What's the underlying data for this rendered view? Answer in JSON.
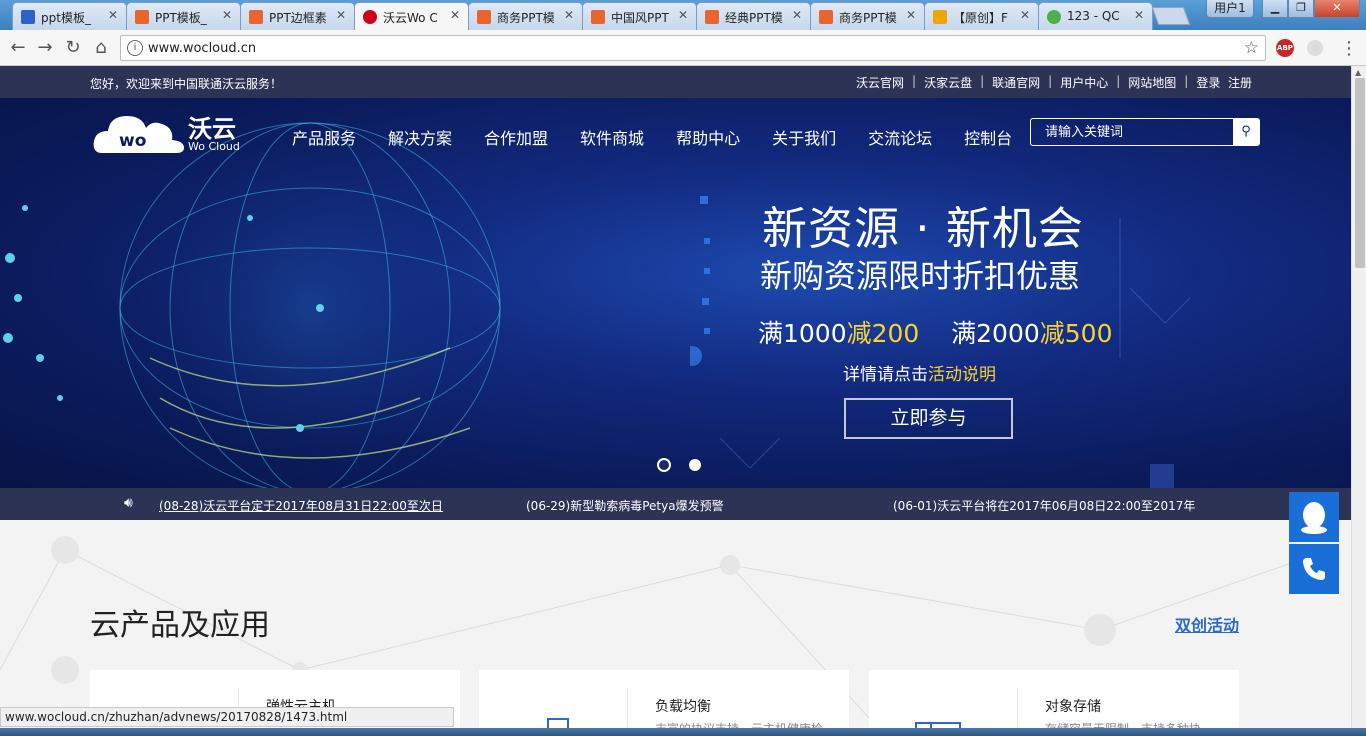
{
  "browser": {
    "tabs": [
      {
        "title": "ppt模板_",
        "fav_color": "#2c62c9"
      },
      {
        "title": "PPT模板_",
        "fav_color": "#e8652d"
      },
      {
        "title": "PPT边框素",
        "fav_color": "#e8652d"
      },
      {
        "title": "沃云Wo C",
        "fav_color": "#d0021b"
      },
      {
        "title": "商务PPT模",
        "fav_color": "#e8652d"
      },
      {
        "title": "中国风PPT",
        "fav_color": "#e8652d"
      },
      {
        "title": "经典PPT模",
        "fav_color": "#e8652d"
      },
      {
        "title": "商务PPT模",
        "fav_color": "#e8652d"
      },
      {
        "title": "【原创】F",
        "fav_color": "#f0a500"
      },
      {
        "title": "123 - QC",
        "fav_color": "#4caf50"
      }
    ],
    "user_label": "用户1",
    "url": "www.wocloud.cn",
    "abp_label": "ABP",
    "status_url": "www.wocloud.cn/zhuzhan/advnews/20170828/1473.html"
  },
  "site": {
    "welcome": "您好，欢迎来到中国联通沃云服务！",
    "top_links": [
      "沃云官网",
      "沃家云盘",
      "联通官网",
      "用户中心",
      "网站地图",
      "登录",
      "注册"
    ],
    "top_sep": "|",
    "logo_cn": "沃云",
    "logo_en": "Wo Cloud",
    "logo_mark": "wo",
    "nav": [
      "产品服务",
      "解决方案",
      "合作加盟",
      "软件商城",
      "帮助中心",
      "关于我们",
      "交流论坛",
      "控制台"
    ],
    "search_placeholder": "请输入关键词"
  },
  "banner": {
    "headline": "新资源 · 新机会",
    "subline": "新购资源限时折扣优惠",
    "offer1_a": "满1000",
    "offer1_b": "减200",
    "offer2_a": "满2000",
    "offer2_b": "减500",
    "detail_a": "详情请点击",
    "detail_b": "活动说明",
    "join_label": "立即参与",
    "active_dot": 1,
    "dots": 2
  },
  "news": [
    "(08-28)沃云平台定于2017年08月31日22:00至次日",
    "(06-29)新型勒索病毒Petya爆发预警",
    "(06-01)沃云平台将在2017年06月08日22:00至2017年"
  ],
  "section": {
    "title": "云产品及应用",
    "link": "双创活动",
    "cards": [
      {
        "title": "弹性云主机",
        "desc": ""
      },
      {
        "title": "负载均衡",
        "desc": "丰富的协议支持，云主机健康检"
      },
      {
        "title": "对象存储",
        "desc": "存储容量无限制，支持多种协"
      }
    ]
  },
  "colors": {
    "accent": "#f7d232",
    "brand": "#2c3355",
    "side_button": "#1a6ed8",
    "link": "#2a6bc6"
  }
}
